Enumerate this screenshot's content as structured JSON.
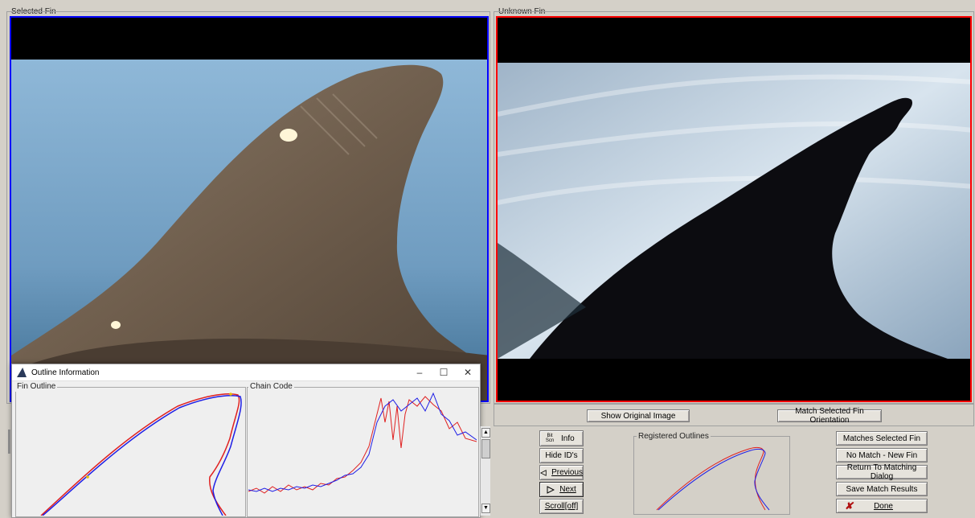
{
  "selected_panel": {
    "label": "Selected Fin",
    "frame_color": "#0000ff"
  },
  "unknown_panel": {
    "label": "Unknown Fin",
    "frame_color": "#ff0000"
  },
  "image_buttons": {
    "show_original": "Show Original Image",
    "match_orientation": "Match Selected Fin Orientation"
  },
  "nav_buttons": {
    "info_icon_text": "Bit\nScn",
    "info": "Info",
    "hide_ids": "Hide ID's",
    "previous": "Previous",
    "next": "Next",
    "scroll": "Scroll[off]"
  },
  "registered": {
    "label": "Registered Outlines"
  },
  "action_buttons": {
    "matches_selected": "Matches Selected Fin",
    "no_match": "No Match - New Fin",
    "return_dialog": "Return To Matching Dialog",
    "save_results": "Save Match Results",
    "done": "Done"
  },
  "outline_window": {
    "title": "Outline Information",
    "minimize": "–",
    "maximize": "☐",
    "close": "✕",
    "fin_outline_label": "Fin Outline",
    "chain_code_label": "Chain Code"
  },
  "colors": {
    "selected_trace": "#1f1fe6",
    "unknown_trace": "#e02020",
    "done_icon": "#b01010"
  },
  "icons": {
    "info": "bit-scan-icon",
    "previous": "left-triangle-icon",
    "next": "right-triangle-icon",
    "done": "red-x-icon",
    "window": "outline-window-icon"
  }
}
